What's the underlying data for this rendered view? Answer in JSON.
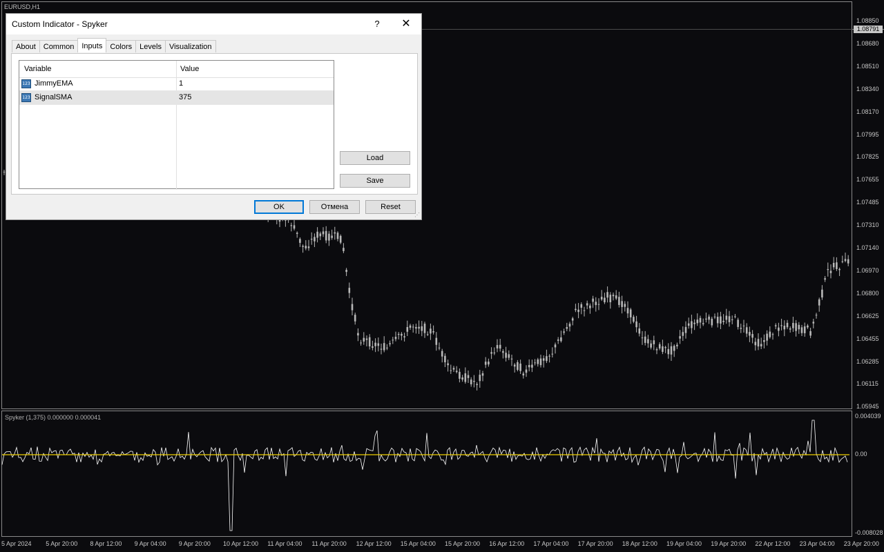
{
  "chart": {
    "symbol_label": "EURUSD,H1",
    "current_price": "1.08791",
    "price_ticks": [
      "1.08850",
      "1.08680",
      "1.08510",
      "1.08340",
      "1.08170",
      "1.07995",
      "1.07825",
      "1.07655",
      "1.07485",
      "1.07310",
      "1.07140",
      "1.06970",
      "1.06800",
      "1.06625",
      "1.06455",
      "1.06285",
      "1.06115",
      "1.05945"
    ],
    "indicator_label": "Spyker (1,375) 0.000000 0.000041",
    "indicator_ticks": [
      "0.004039",
      "0.00",
      "-0.008028"
    ],
    "time_ticks": [
      "5 Apr 2024",
      "5 Apr 20:00",
      "8 Apr 12:00",
      "9 Apr 04:00",
      "9 Apr 20:00",
      "10 Apr 12:00",
      "11 Apr 04:00",
      "11 Apr 20:00",
      "12 Apr 12:00",
      "15 Apr 04:00",
      "15 Apr 20:00",
      "16 Apr 12:00",
      "17 Apr 04:00",
      "17 Apr 20:00",
      "18 Apr 12:00",
      "19 Apr 04:00",
      "19 Apr 20:00",
      "22 Apr 12:00",
      "23 Apr 04:00",
      "23 Apr 20:00"
    ],
    "colors": {
      "background": "#0b0b0e",
      "candles": "#b8b8b8",
      "indicator_line": "#ffffff",
      "signal_line": "#f0d000"
    }
  },
  "dialog": {
    "title": "Custom Indicator - Spyker",
    "help_glyph": "?",
    "close_glyph": "✕",
    "tabs": [
      {
        "label": "About"
      },
      {
        "label": "Common"
      },
      {
        "label": "Inputs"
      },
      {
        "label": "Colors"
      },
      {
        "label": "Levels"
      },
      {
        "label": "Visualization"
      }
    ],
    "active_tab": "Inputs",
    "grid": {
      "col_variable": "Variable",
      "col_value": "Value",
      "rows": [
        {
          "icon": "numeric-input-icon",
          "icon_text": "123",
          "name": "JimmyEMA",
          "value": "1"
        },
        {
          "icon": "numeric-input-icon",
          "icon_text": "123",
          "name": "SignalSMA",
          "value": "375"
        }
      ]
    },
    "buttons": {
      "load": "Load",
      "save": "Save",
      "ok": "OK",
      "cancel": "Отмена",
      "reset": "Reset"
    }
  }
}
